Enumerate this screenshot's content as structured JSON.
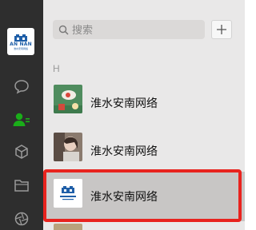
{
  "search": {
    "placeholder": "搜索"
  },
  "toolbar": {
    "add_label": "+"
  },
  "profile": {
    "logo_text": "AN NAN",
    "logo_subtext": "淮水安南网络"
  },
  "contacts": {
    "section_letter": "H",
    "items": [
      {
        "name": "淮水安南网络"
      },
      {
        "name": "淮水安南网络"
      },
      {
        "name": "淮水安南网络",
        "selected": true
      }
    ]
  },
  "colors": {
    "rail_bg": "#2e2e2e",
    "list_bg": "#e9e8e8",
    "accent": "#1aad19",
    "highlight": "#e8231e"
  }
}
